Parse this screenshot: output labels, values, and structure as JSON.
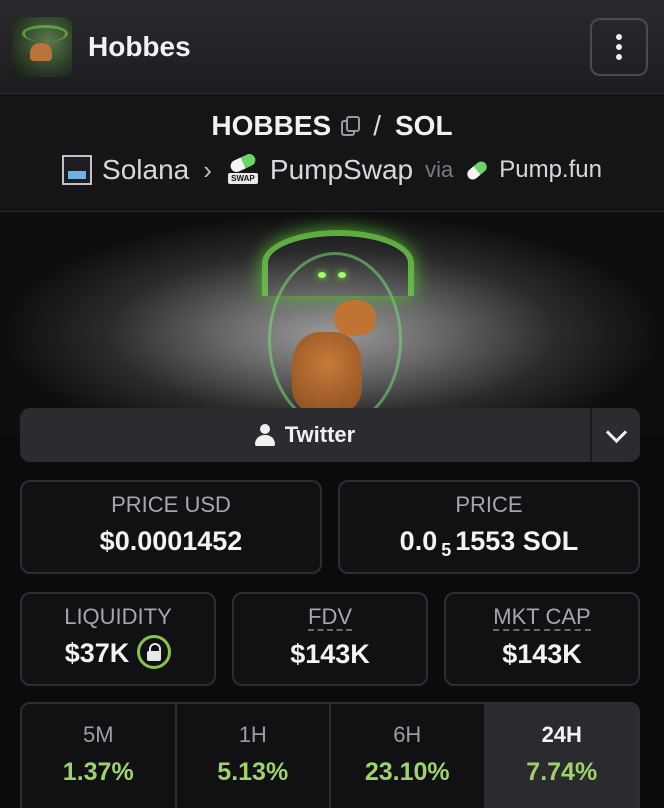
{
  "header": {
    "token_name": "Hobbes",
    "menu_icon": "more-vertical-icon"
  },
  "pair": {
    "base": "HOBBES",
    "separator": "/",
    "quote": "SOL"
  },
  "route": {
    "chain": "Solana",
    "dex": "PumpSwap",
    "dex_badge": "SWAP",
    "via": "via",
    "launchpad": "Pump.fun"
  },
  "social": {
    "twitter_label": "Twitter"
  },
  "stats": {
    "price_usd_label": "PRICE USD",
    "price_usd": "$0.0001452",
    "price_label": "PRICE",
    "price_sol_prefix": "0.0",
    "price_sol_sub": "5",
    "price_sol_rest": "1553 SOL",
    "liquidity_label": "LIQUIDITY",
    "liquidity": "$37K",
    "fdv_label": "FDV",
    "fdv": "$143K",
    "mktcap_label": "MKT CAP",
    "mktcap": "$143K"
  },
  "changes": [
    {
      "period": "5M",
      "value": "1.37%"
    },
    {
      "period": "1H",
      "value": "5.13%"
    },
    {
      "period": "6H",
      "value": "23.10%"
    },
    {
      "period": "24H",
      "value": "7.74%",
      "active": true
    }
  ],
  "colors": {
    "positive": "#9ed36a",
    "accent_glow": "#6fd04a"
  }
}
